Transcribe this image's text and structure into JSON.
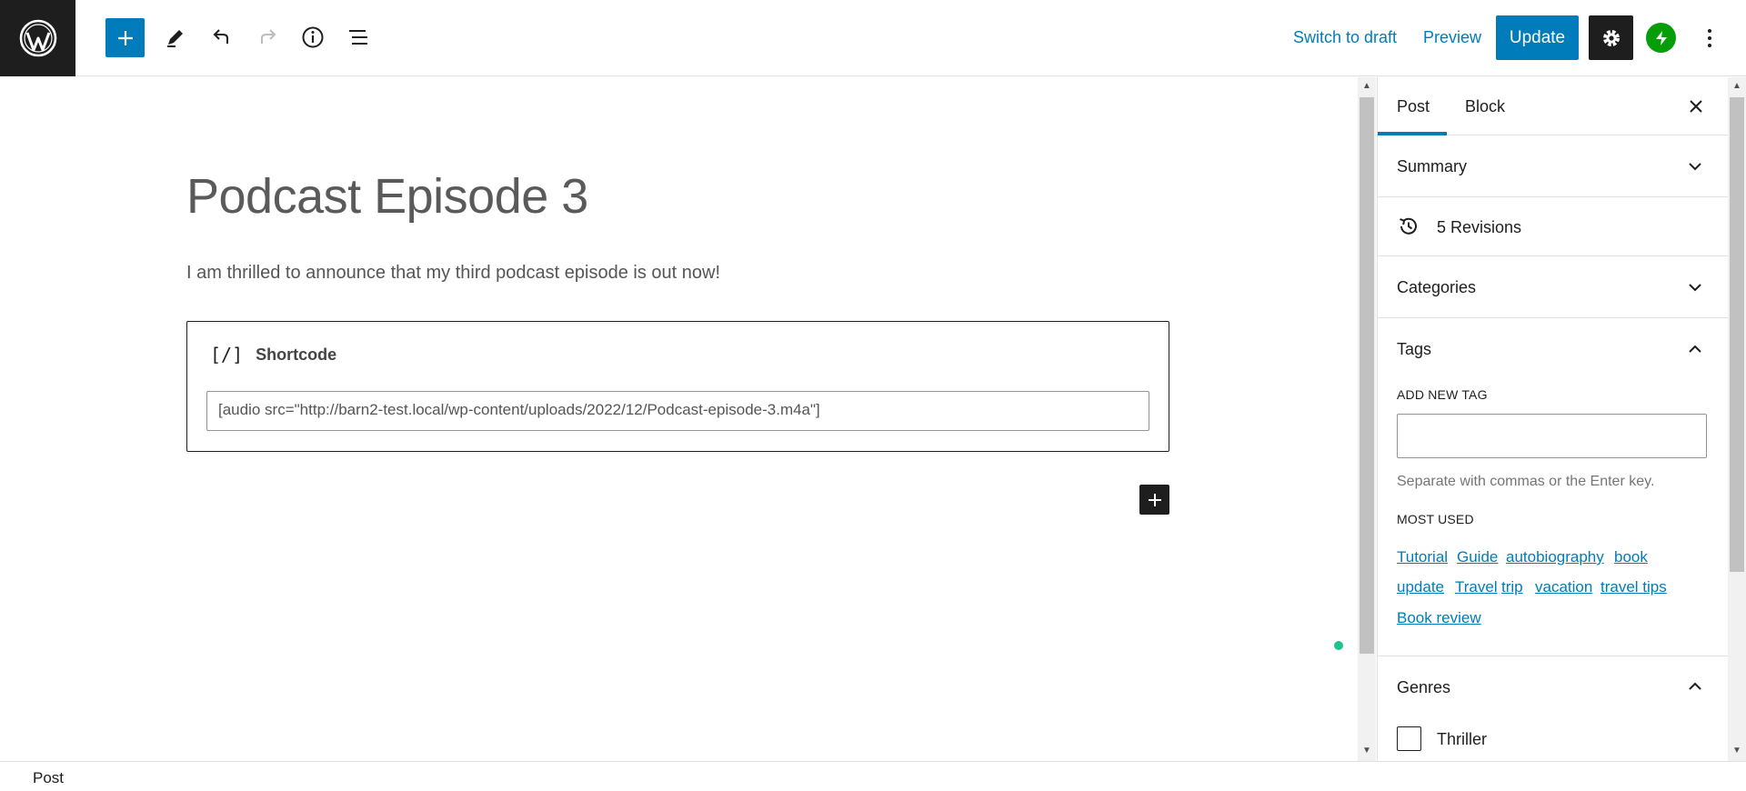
{
  "toolbar": {
    "switch_to_draft": "Switch to draft",
    "preview": "Preview",
    "update": "Update"
  },
  "post": {
    "title": "Podcast Episode 3",
    "paragraph": "I am thrilled to announce that my third podcast episode is out now!"
  },
  "shortcode_block": {
    "icon_glyph": "[/]",
    "label": "Shortcode",
    "value": "[audio src=\"http://barn2-test.local/wp-content/uploads/2022/12/Podcast-episode-3.m4a\"]"
  },
  "sidebar": {
    "tabs": [
      {
        "label": "Post",
        "active": true
      },
      {
        "label": "Block",
        "active": false
      }
    ],
    "summary": "Summary",
    "revisions": "5 Revisions",
    "categories": "Categories",
    "tags": {
      "title": "Tags",
      "add_new_label": "ADD NEW TAG",
      "input_value": "",
      "help": "Separate with commas or the Enter key.",
      "most_used_label": "MOST USED",
      "most_used": [
        "Tutorial",
        "Guide",
        "autobiography",
        "book",
        "update",
        "Travel",
        "trip",
        "vacation",
        "travel tips",
        "Book review"
      ]
    },
    "genres": {
      "title": "Genres",
      "options": [
        {
          "label": "Thriller",
          "checked": false
        }
      ]
    }
  },
  "footer": {
    "breadcrumb": "Post"
  },
  "colors": {
    "accent": "#007cba",
    "dark": "#1e1e1e",
    "jetpack_green": "#069e08",
    "status_dot": "#1ec28b"
  }
}
